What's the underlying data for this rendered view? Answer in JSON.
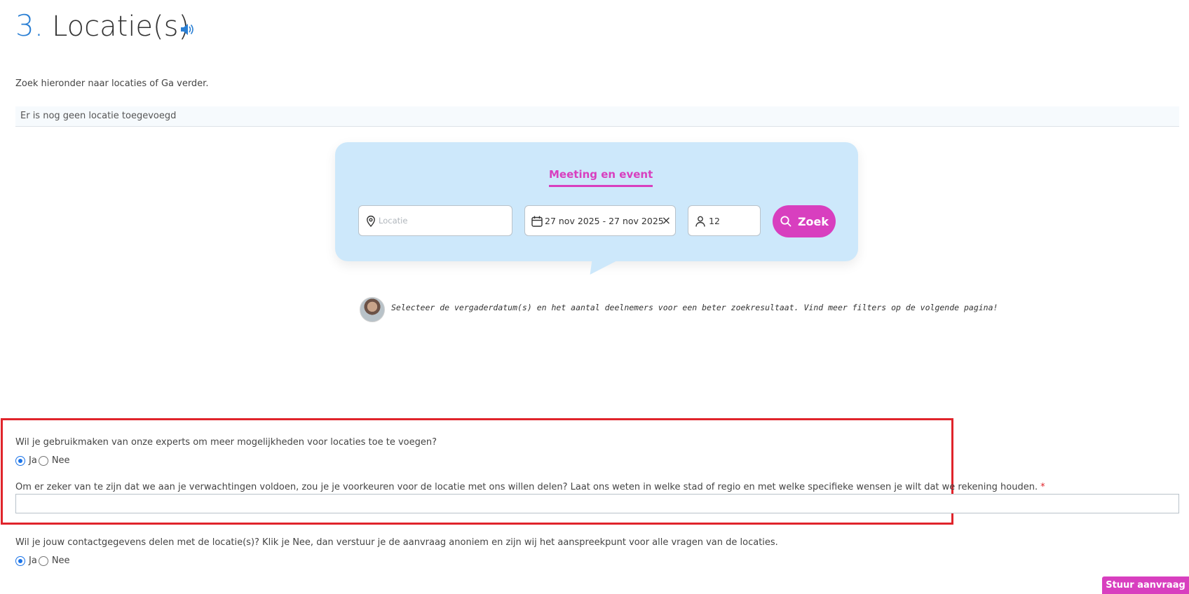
{
  "section": {
    "number": "3.",
    "title": "Locatie(s)"
  },
  "intro_text": "Zoek hieronder naar locaties of Ga verder.",
  "empty_state": "Er is nog geen locatie toegevoegd",
  "search": {
    "tab_label": "Meeting en event",
    "location_placeholder": "Locatie",
    "date_range": "27 nov 2025 - 27 nov 2025",
    "clear_label": "×",
    "guests": "12",
    "button_label": "Zoek"
  },
  "hint_text": "Selecteer de vergaderdatum(s) en het aantal deelnemers voor een beter zoekresultaat. Vind meer filters op de volgende pagina!",
  "questions": {
    "experts": {
      "label": "Wil je gebruikmaken van onze experts om meer mogelijkheden voor locaties toe te voegen?",
      "options": [
        "Ja",
        "Nee"
      ],
      "selected": "Ja"
    },
    "preferences": {
      "label": "Om er zeker van te zijn dat we aan je verwachtingen voldoen, zou je je voorkeuren voor de locatie met ons willen delen? Laat ons weten in welke stad of regio en met welke specifieke wensen je wilt dat we rekening houden.",
      "required_mark": "*",
      "value": ""
    },
    "share_contact": {
      "label": "Wil je jouw contactgegevens delen met de locatie(s)? Klik je Nee, dan verstuur je de aanvraag anoniem en zijn wij het aanspreekpunt voor alle vragen van de locaties.",
      "options": [
        "Ja",
        "Nee"
      ],
      "selected": "Ja"
    }
  },
  "submit_label": "Stuur aanvraag",
  "colors": {
    "accent": "#d83fbf",
    "panel": "#cde8fb",
    "highlight": "#e0242b",
    "number": "#2a7fd4"
  }
}
